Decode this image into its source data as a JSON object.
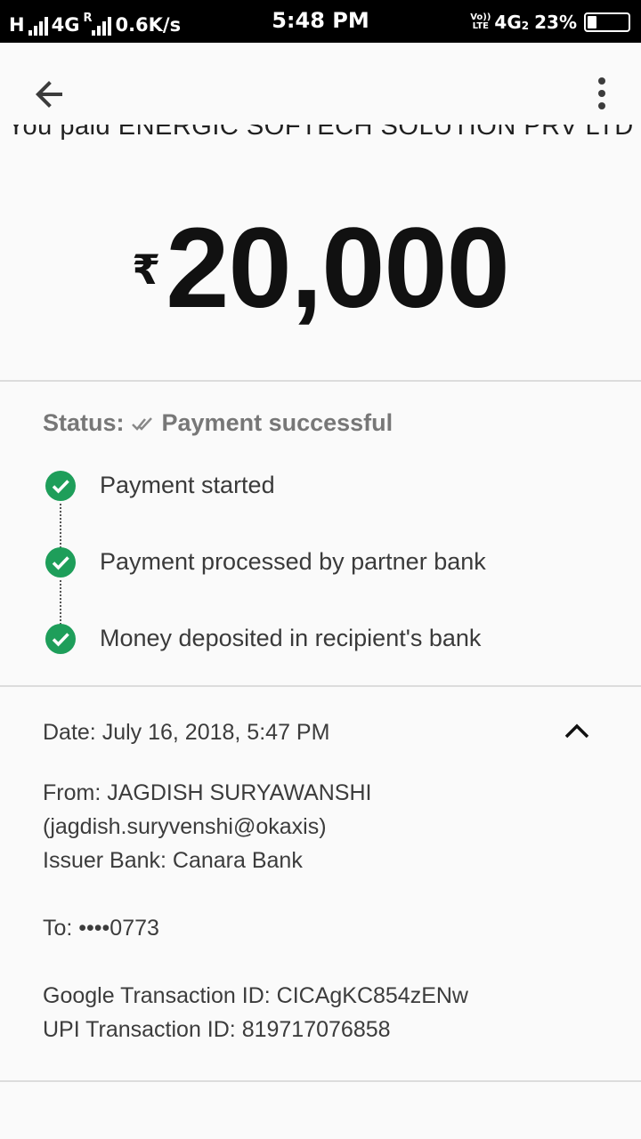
{
  "statusbar": {
    "network1": "H",
    "network2": "4G",
    "roaming": "R",
    "speed": "0.6K/s",
    "time": "5:48 PM",
    "volte_top": "Vo))",
    "volte_bottom": "LTE",
    "network3": "4G",
    "sim": "2",
    "battery": "23%"
  },
  "appbar": {
    "back_icon": "arrow-back-icon",
    "more_icon": "more-vert-icon"
  },
  "payment": {
    "paid_to": "You paid ENERGIC SOFTECH SOLUTION PRV LTD",
    "currency": "₹",
    "amount": "20,000"
  },
  "status": {
    "label": "Status:",
    "value": "Payment successful",
    "steps": [
      {
        "label": "Payment started"
      },
      {
        "label": "Payment processed by partner bank"
      },
      {
        "label": "Money deposited in recipient's bank"
      }
    ]
  },
  "details": {
    "date": "Date: July 16, 2018, 5:47 PM",
    "from": "From: JAGDISH SURYAWANSHI",
    "from_vpa": "(jagdish.suryvenshi@okaxis)",
    "issuer": "Issuer Bank: Canara Bank",
    "to": "To: ••••0773",
    "google_txn": "Google Transaction ID: CICAgKC854zENw",
    "upi_txn": "UPI Transaction ID: 819717076858"
  },
  "colors": {
    "success_green": "#1e9e5a",
    "background": "#fafafa",
    "statusbar": "#000000"
  },
  "battery_level": 0.23
}
